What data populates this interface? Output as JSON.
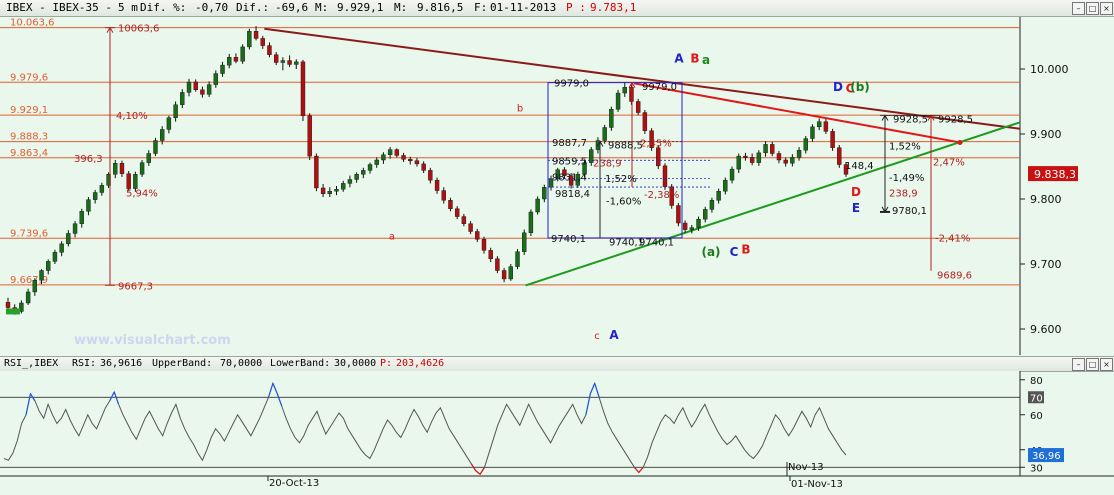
{
  "header": {
    "symbol": "IBEX - IBEX-35 -",
    "interval": "5 m",
    "dif_pct_label": "Dif. %:",
    "dif_pct": "-0,70",
    "dif_label": "Dif.:",
    "dif": "-69,6",
    "m_label": "M:",
    "m": "9.929,1",
    "m2_label": "M:",
    "m2": "9.816,5",
    "f_label": "F:",
    "date": "01-11-2013",
    "p_label": "P :",
    "price": "9.783,1"
  },
  "sub_header": {
    "name": "RSI_,IBEX",
    "rsi_label": "RSI:",
    "rsi": "36,9616",
    "upper_label": "UpperBand:",
    "upper": "70,0000",
    "lower_label": "LowerBand:",
    "lower": "30,0000",
    "p_label": "P:",
    "p": "203,4626"
  },
  "watermark": "www.visualchart.com",
  "colors": {
    "background": "#e9f7ed",
    "horizontal_levels": "#e06030",
    "descending_trend": "#8b1a1a",
    "red_trend": "#e01818",
    "rising_trend": "#1e9a1e",
    "measure_lines": "#b22222",
    "box": "#2222cc",
    "candle_up": "#1a6b1a",
    "candle_down": "#b01010",
    "rsi_line": "#555555",
    "rsi_over": "#1e5ad8",
    "rsi_under": "#e01818",
    "current_price_bg": "#c81212"
  },
  "chart_data": [
    {
      "type": "candlestick",
      "title": "IBEX - IBEX-35 - 5 m",
      "ylim": [
        9560,
        10080
      ],
      "y_ticks": [
        "10.000",
        "9.900",
        "9.800",
        "9.700",
        "9.600"
      ],
      "x_tick_labels": [
        "20-Oct-13",
        "Nov-13",
        "01-Nov-13"
      ],
      "current_price_label": "9.838,3",
      "level_labels": [
        "10.063,6",
        "9.979,6",
        "9.929,1",
        "9.888,3",
        "9.863,4",
        "9.739,6",
        "9.667,9"
      ],
      "annotations": [
        "10063,6",
        "9667,3",
        "4,10%",
        "396,3",
        "5,94%",
        "9979,0",
        "9979,0",
        "9887,7",
        "9888,5",
        "9859,5",
        "9831,4",
        "238,9",
        "2,45%",
        "1,52%",
        "-2,38%",
        "9818,4",
        "-1,60%",
        "9740,1",
        "9740,1",
        "9740,1",
        "9928,5",
        "9928,5",
        "1,52%",
        "148,4",
        "-1,49%",
        "238,9",
        "9780,1",
        "2,47%",
        "-2,41%",
        "9689,6"
      ],
      "wave_labels": [
        "A",
        "a",
        "B",
        "b",
        "a",
        "c",
        "A",
        "D",
        "C",
        "(b)",
        "(a)",
        "C",
        "B",
        "D",
        "E"
      ],
      "price_path": [
        [
          0,
          9640
        ],
        [
          3,
          9625
        ],
        [
          5,
          9640
        ],
        [
          8,
          9675
        ],
        [
          11,
          9705
        ],
        [
          13,
          9732
        ],
        [
          16,
          9762
        ],
        [
          19,
          9800
        ],
        [
          22,
          9822
        ],
        [
          25,
          9856
        ],
        [
          28,
          9815
        ],
        [
          31,
          9868
        ],
        [
          34,
          9905
        ],
        [
          37,
          9945
        ],
        [
          40,
          9980
        ],
        [
          43,
          9962
        ],
        [
          46,
          10003
        ],
        [
          49,
          10020
        ],
        [
          52,
          10062
        ],
        [
          55,
          10035
        ],
        [
          57,
          10013
        ],
        [
          60,
          10005
        ],
        [
          62,
          10012
        ],
        [
          63,
          9930
        ],
        [
          65,
          9820
        ],
        [
          67,
          9808
        ],
        [
          70,
          9815
        ],
        [
          73,
          9830
        ],
        [
          76,
          9845
        ],
        [
          79,
          9860
        ],
        [
          82,
          9875
        ],
        [
          85,
          9860
        ],
        [
          88,
          9858
        ],
        [
          91,
          9820
        ],
        [
          94,
          9790
        ],
        [
          97,
          9755
        ],
        [
          100,
          9735
        ],
        [
          103,
          9700
        ],
        [
          105,
          9677
        ],
        [
          107,
          9735
        ],
        [
          110,
          9815
        ],
        [
          113,
          9845
        ],
        [
          116,
          9818
        ],
        [
          119,
          9870
        ],
        [
          122,
          9900
        ],
        [
          125,
          9970
        ],
        [
          127,
          9940
        ],
        [
          130,
          9880
        ],
        [
          133,
          9810
        ],
        [
          135,
          9760
        ],
        [
          138,
          9752
        ],
        [
          141,
          9800
        ],
        [
          144,
          9830
        ],
        [
          147,
          9870
        ],
        [
          150,
          9865
        ],
        [
          153,
          9885
        ],
        [
          156,
          9855
        ],
        [
          159,
          9880
        ],
        [
          162,
          9920
        ],
        [
          165,
          9895
        ],
        [
          168,
          9855
        ],
        [
          170,
          9838
        ]
      ],
      "ohlc": [
        [
          9641,
          9648,
          9630,
          9633
        ],
        [
          9633,
          9638,
          9622,
          9627
        ],
        [
          9627,
          9644,
          9624,
          9640
        ],
        [
          9640,
          9662,
          9637,
          9657
        ],
        [
          9657,
          9678,
          9651,
          9675
        ],
        [
          9675,
          9692,
          9669,
          9690
        ],
        [
          9690,
          9707,
          9684,
          9704
        ],
        [
          9704,
          9722,
          9700,
          9718
        ],
        [
          9718,
          9735,
          9712,
          9731
        ],
        [
          9731,
          9752,
          9727,
          9747
        ],
        [
          9747,
          9766,
          9741,
          9762
        ],
        [
          9762,
          9785,
          9756,
          9781
        ],
        [
          9781,
          9803,
          9775,
          9799
        ],
        [
          9799,
          9814,
          9793,
          9810
        ],
        [
          9810,
          9825,
          9805,
          9821
        ],
        [
          9821,
          9841,
          9817,
          9838
        ],
        [
          9838,
          9860,
          9832,
          9855
        ],
        [
          9855,
          9859,
          9834,
          9839
        ],
        [
          9839,
          9843,
          9812,
          9816
        ],
        [
          9816,
          9842,
          9811,
          9838
        ],
        [
          9838,
          9860,
          9834,
          9856
        ],
        [
          9856,
          9875,
          9851,
          9870
        ],
        [
          9870,
          9894,
          9866,
          9890
        ],
        [
          9890,
          9912,
          9884,
          9907
        ],
        [
          9907,
          9928,
          9901,
          9925
        ],
        [
          9925,
          9950,
          9919,
          9945
        ],
        [
          9945,
          9969,
          9940,
          9964
        ],
        [
          9964,
          9985,
          9958,
          9980
        ],
        [
          9980,
          9984,
          9965,
          9968
        ],
        [
          9968,
          9973,
          9956,
          9961
        ],
        [
          9961,
          9981,
          9957,
          9976
        ],
        [
          9976,
          9998,
          9971,
          9993
        ],
        [
          9993,
          10011,
          9988,
          10006
        ],
        [
          10006,
          10023,
          10001,
          10018
        ],
        [
          10018,
          10024,
          10009,
          10012
        ],
        [
          10012,
          10038,
          10008,
          10034
        ],
        [
          10034,
          10062,
          10030,
          10058
        ],
        [
          10058,
          10066,
          10044,
          10047
        ],
        [
          10047,
          10051,
          10031,
          10036
        ],
        [
          10036,
          10041,
          10018,
          10022
        ],
        [
          10022,
          10026,
          10006,
          10010
        ],
        [
          10010,
          10018,
          9998,
          10013
        ],
        [
          10013,
          10021,
          10003,
          10007
        ],
        [
          10007,
          10015,
          10000,
          10011
        ],
        [
          10011,
          10014,
          9920,
          9928
        ],
        [
          9928,
          9932,
          9860,
          9866
        ],
        [
          9866,
          9870,
          9812,
          9817
        ],
        [
          9817,
          9823,
          9803,
          9808
        ],
        [
          9808,
          9818,
          9803,
          9812
        ],
        [
          9812,
          9820,
          9806,
          9815
        ],
        [
          9815,
          9828,
          9811,
          9824
        ],
        [
          9824,
          9836,
          9818,
          9830
        ],
        [
          9830,
          9841,
          9825,
          9838
        ],
        [
          9838,
          9848,
          9832,
          9844
        ],
        [
          9844,
          9856,
          9839,
          9853
        ],
        [
          9853,
          9864,
          9848,
          9860
        ],
        [
          9860,
          9872,
          9854,
          9868
        ],
        [
          9868,
          9880,
          9862,
          9876
        ],
        [
          9876,
          9878,
          9864,
          9867
        ],
        [
          9867,
          9871,
          9857,
          9861
        ],
        [
          9861,
          9865,
          9853,
          9859
        ],
        [
          9859,
          9863,
          9850,
          9854
        ],
        [
          9854,
          9858,
          9840,
          9844
        ],
        [
          9844,
          9848,
          9824,
          9829
        ],
        [
          9829,
          9833,
          9808,
          9813
        ],
        [
          9813,
          9818,
          9793,
          9798
        ],
        [
          9798,
          9802,
          9781,
          9785
        ],
        [
          9785,
          9789,
          9769,
          9773
        ],
        [
          9773,
          9777,
          9758,
          9762
        ],
        [
          9762,
          9766,
          9746,
          9750
        ],
        [
          9750,
          9754,
          9734,
          9738
        ],
        [
          9738,
          9742,
          9716,
          9721
        ],
        [
          9721,
          9725,
          9703,
          9708
        ],
        [
          9708,
          9712,
          9686,
          9690
        ],
        [
          9690,
          9694,
          9672,
          9677
        ],
        [
          9677,
          9700,
          9674,
          9696
        ],
        [
          9696,
          9723,
          9692,
          9719
        ],
        [
          9719,
          9753,
          9714,
          9748
        ],
        [
          9748,
          9784,
          9743,
          9780
        ],
        [
          9780,
          9804,
          9776,
          9800
        ],
        [
          9800,
          9822,
          9795,
          9818
        ],
        [
          9818,
          9836,
          9813,
          9831
        ],
        [
          9831,
          9848,
          9827,
          9845
        ],
        [
          9845,
          9849,
          9831,
          9836
        ],
        [
          9836,
          9840,
          9816,
          9821
        ],
        [
          9821,
          9842,
          9817,
          9838
        ],
        [
          9838,
          9861,
          9833,
          9856
        ],
        [
          9856,
          9880,
          9851,
          9876
        ],
        [
          9876,
          9895,
          9870,
          9890
        ],
        [
          9890,
          9914,
          9885,
          9910
        ],
        [
          9910,
          9942,
          9905,
          9938
        ],
        [
          9938,
          9968,
          9934,
          9963
        ],
        [
          9963,
          9980,
          9957,
          9972
        ],
        [
          9972,
          9976,
          9945,
          9950
        ],
        [
          9950,
          9954,
          9929,
          9933
        ],
        [
          9933,
          9937,
          9900,
          9905
        ],
        [
          9905,
          9909,
          9874,
          9879
        ],
        [
          9879,
          9883,
          9846,
          9851
        ],
        [
          9851,
          9855,
          9814,
          9819
        ],
        [
          9819,
          9823,
          9785,
          9790
        ],
        [
          9790,
          9794,
          9758,
          9763
        ],
        [
          9763,
          9767,
          9748,
          9753
        ],
        [
          9753,
          9760,
          9747,
          9756
        ],
        [
          9756,
          9773,
          9751,
          9769
        ],
        [
          9769,
          9788,
          9764,
          9784
        ],
        [
          9784,
          9802,
          9779,
          9798
        ],
        [
          9798,
          9816,
          9793,
          9812
        ],
        [
          9812,
          9833,
          9807,
          9829
        ],
        [
          9829,
          9850,
          9824,
          9846
        ],
        [
          9846,
          9870,
          9840,
          9866
        ],
        [
          9866,
          9871,
          9859,
          9864
        ],
        [
          9864,
          9870,
          9852,
          9856
        ],
        [
          9856,
          9875,
          9851,
          9871
        ],
        [
          9871,
          9889,
          9865,
          9884
        ],
        [
          9884,
          9888,
          9866,
          9870
        ],
        [
          9870,
          9874,
          9855,
          9860
        ],
        [
          9860,
          9864,
          9850,
          9855
        ],
        [
          9855,
          9869,
          9850,
          9864
        ],
        [
          9864,
          9880,
          9859,
          9875
        ],
        [
          9875,
          9897,
          9870,
          9893
        ],
        [
          9893,
          9915,
          9888,
          9911
        ],
        [
          9911,
          9924,
          9906,
          9919
        ],
        [
          9919,
          9923,
          9900,
          9904
        ],
        [
          9904,
          9908,
          9874,
          9879
        ],
        [
          9879,
          9883,
          9848,
          9853
        ],
        [
          9853,
          9857,
          9834,
          9838
        ]
      ]
    },
    {
      "type": "line",
      "title": "RSI_,IBEX",
      "ylim": [
        25,
        85
      ],
      "y_ticks": [
        "80",
        "60",
        "40",
        "30"
      ],
      "bands": {
        "upper": 70,
        "lower": 30
      },
      "current_value_label": "36,96",
      "series": [
        {
          "name": "RSI",
          "values": [
            35,
            34,
            38,
            45,
            55,
            60,
            72,
            68,
            62,
            58,
            66,
            60,
            55,
            58,
            63,
            57,
            52,
            48,
            54,
            60,
            55,
            52,
            58,
            64,
            68,
            73,
            66,
            60,
            55,
            50,
            46,
            52,
            58,
            62,
            57,
            52,
            48,
            55,
            61,
            66,
            58,
            52,
            47,
            43,
            38,
            34,
            40,
            47,
            52,
            49,
            45,
            50,
            55,
            60,
            56,
            52,
            48,
            53,
            58,
            64,
            70,
            78,
            72,
            65,
            58,
            52,
            47,
            44,
            48,
            54,
            58,
            62,
            55,
            49,
            53,
            57,
            61,
            58,
            52,
            48,
            44,
            40,
            37,
            35,
            40,
            46,
            52,
            57,
            54,
            50,
            47,
            52,
            58,
            63,
            59,
            54,
            50,
            56,
            61,
            64,
            58,
            52,
            48,
            44,
            40,
            36,
            32,
            28,
            26,
            30,
            38,
            46,
            54,
            60,
            66,
            62,
            58,
            54,
            60,
            66,
            61,
            56,
            52,
            48,
            44,
            49,
            54,
            58,
            62,
            66,
            60,
            55,
            60,
            72,
            78,
            70,
            62,
            55,
            50,
            46,
            42,
            38,
            34,
            30,
            27,
            30,
            36,
            44,
            50,
            56,
            60,
            58,
            55,
            60,
            64,
            58,
            53,
            57,
            62,
            66,
            60,
            55,
            50,
            46,
            43,
            45,
            48,
            44,
            40,
            37,
            35,
            38,
            42,
            48,
            54,
            60,
            57,
            52,
            48,
            52,
            57,
            62,
            58,
            53,
            60,
            64,
            58,
            52,
            48,
            44,
            40,
            37
          ]
        }
      ]
    }
  ]
}
